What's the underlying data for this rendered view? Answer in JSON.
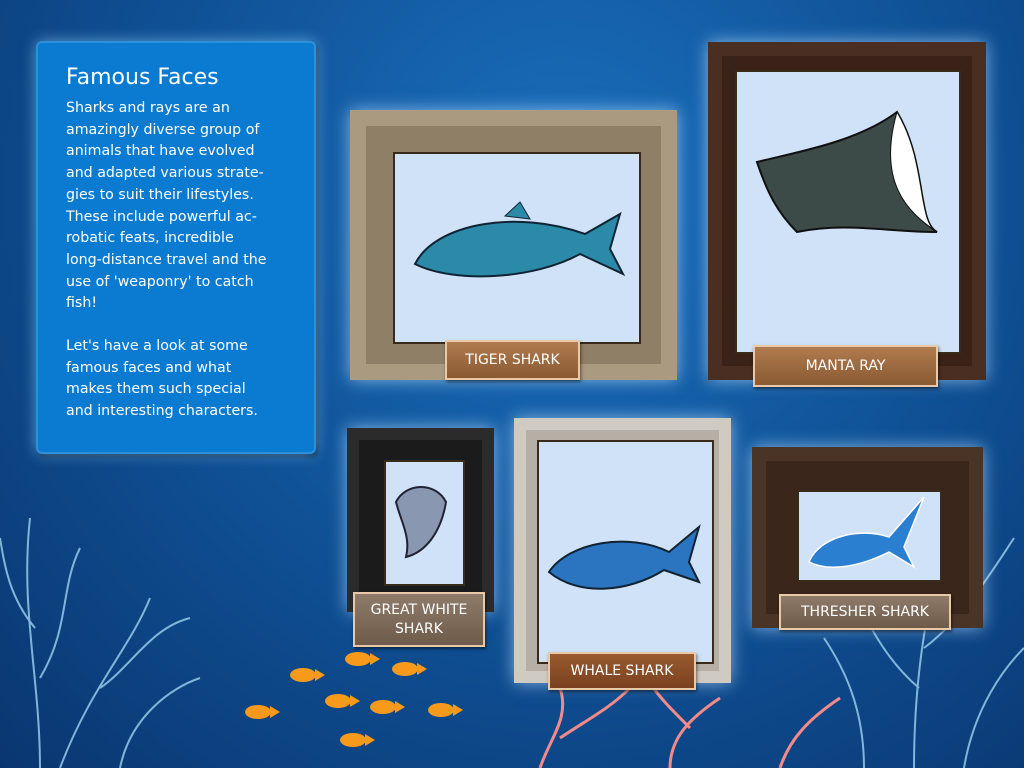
{
  "panel": {
    "title": "Famous Faces",
    "paragraph1": "Sharks and rays are an\namazingly diverse group of\nanimals that have evolved\nand adapted various strate-\ngies to suit their lifestyles.\nThese include powerful ac-\nrobatic feats, incredible\nlong-distance travel and the\nuse of 'weaponry' to catch\nfish!",
    "paragraph2": "Let's have a look at some\nfamous faces and what\nmakes them such special\nand interesting characters."
  },
  "frames": [
    {
      "label": "TIGER SHARK",
      "icon": "tiger-shark"
    },
    {
      "label": "MANTA RAY",
      "icon": "manta-ray"
    },
    {
      "label": "GREAT WHITE SHARK",
      "icon": "great-white-shark"
    },
    {
      "label": "WHALE SHARK",
      "icon": "whale-shark"
    },
    {
      "label": "THRESHER SHARK",
      "icon": "thresher-shark"
    }
  ],
  "colors": {
    "panel": "#0a7bd0",
    "fish": "#f79a1c",
    "inner": "#cfe2f7"
  }
}
